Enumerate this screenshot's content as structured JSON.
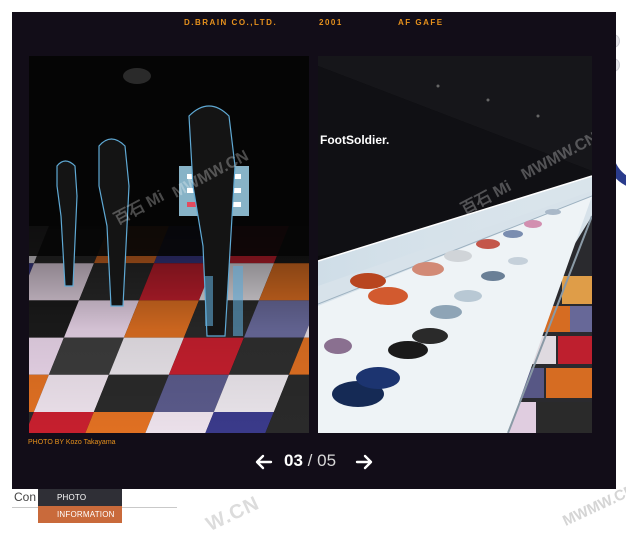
{
  "header": {
    "company": "D.BRAIN CO.,LTD.",
    "year": "2001",
    "venue": "AF GAFE"
  },
  "photos": {
    "left": {
      "sign": ""
    },
    "right": {
      "sign": "FootSoldier."
    }
  },
  "credit": "PHOTO BY Kozo Takayama",
  "pager": {
    "current": "03",
    "separator": "/",
    "total": "05",
    "prev_icon": "arrow-left-icon",
    "next_icon": "arrow-right-icon"
  },
  "watermarks": {
    "text": "MWMW.CN",
    "cn_text": "百石 Mi"
  },
  "background": {
    "partial_label": "Con",
    "menu": [
      {
        "label": "PHOTO"
      },
      {
        "label": "INFORMATION"
      }
    ],
    "watermark": "W.CN",
    "watermark2": "MWMW.CN"
  },
  "colors": {
    "accent": "#e6911d",
    "lightbox_bg": "#120d18",
    "menu_dark": "#2f2f36",
    "menu_orange": "#c96a3b"
  }
}
